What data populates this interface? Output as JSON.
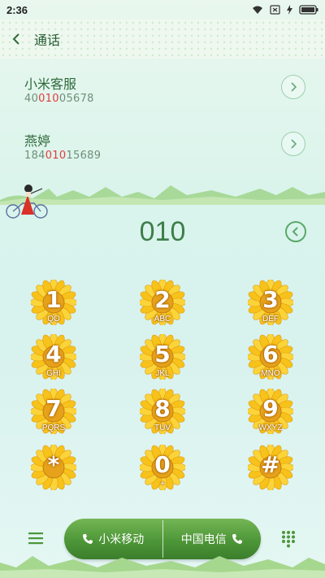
{
  "status": {
    "time": "2:36"
  },
  "header": {
    "title": "通话"
  },
  "contacts": [
    {
      "name": "小米客服",
      "number_pre": "40",
      "number_hl": "010",
      "number_post": "05678"
    },
    {
      "name": "燕婷",
      "number_pre": "184",
      "number_hl": "010",
      "number_post": "15689"
    }
  ],
  "dial": {
    "number": "010"
  },
  "keypad": [
    {
      "digit": "1",
      "letters": "QO"
    },
    {
      "digit": "2",
      "letters": "ABC"
    },
    {
      "digit": "3",
      "letters": "DEF"
    },
    {
      "digit": "4",
      "letters": "GHI"
    },
    {
      "digit": "5",
      "letters": "JKL"
    },
    {
      "digit": "6",
      "letters": "MNO"
    },
    {
      "digit": "7",
      "letters": "PQRS"
    },
    {
      "digit": "8",
      "letters": "TUV"
    },
    {
      "digit": "9",
      "letters": "WXYZ"
    },
    {
      "digit": "*",
      "letters": ""
    },
    {
      "digit": "0",
      "letters": "+"
    },
    {
      "digit": "#",
      "letters": ""
    }
  ],
  "calls": {
    "sim1": "小米移动",
    "sim2": "中国电信"
  },
  "colors": {
    "accent": "#4d9638",
    "highlight": "#e23b3b",
    "title": "#245c32"
  },
  "icons": [
    "wifi-icon",
    "sim-off-icon",
    "battery-charging-icon",
    "back-arrow-icon",
    "chevron-right-icon",
    "backspace-icon",
    "menu-icon",
    "phone-icon",
    "dialpad-icon"
  ]
}
